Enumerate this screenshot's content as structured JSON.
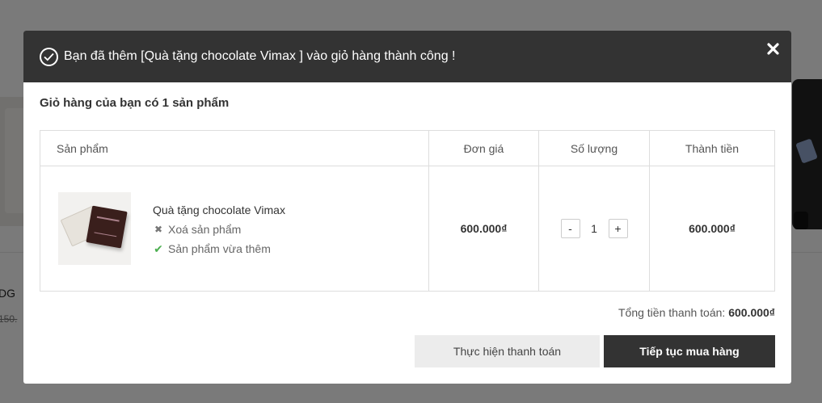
{
  "background": {
    "product_name_fragment": "DG",
    "old_price_fragment": "150."
  },
  "modal": {
    "header_title": "Bạn đã thêm [Quà tặng chocolate Vimax ] vào giỏ hàng thành công !",
    "cart_count_text": "Giỏ hàng của bạn có 1 sản phẩm",
    "columns": [
      "Sản phẩm",
      "Đơn giá",
      "Số lượng",
      "Thành tiền"
    ],
    "item": {
      "name": "Quà tặng chocolate Vimax",
      "remove_label": "Xoá sản phẩm",
      "added_label": "Sản phẩm vừa thêm",
      "unit_price": "600.000₫",
      "quantity": "1",
      "qty_minus": "-",
      "qty_plus": "+",
      "line_total": "600.000₫"
    },
    "total_label": "Tổng tiền thanh toán:",
    "total_value": "600.000₫",
    "checkout_button": "Thực hiện thanh toán",
    "continue_button": "Tiếp tục mua hàng",
    "icons": {
      "header": "check-circle-icon",
      "close": "close-icon",
      "remove": "x-icon",
      "added": "check-icon"
    },
    "colors": {
      "header_bg": "#333333",
      "primary_button": "#333333",
      "secondary_button": "#ececec",
      "added_check": "#4caf50"
    }
  }
}
